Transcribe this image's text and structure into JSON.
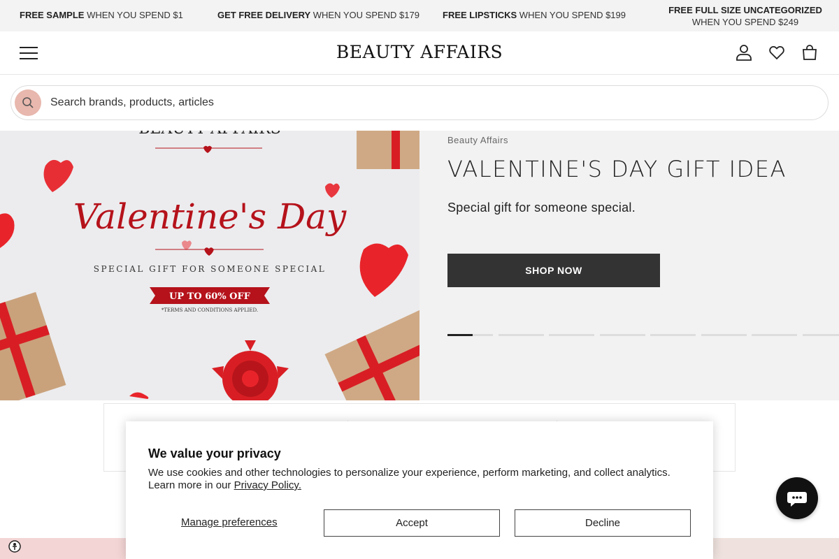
{
  "promo_bar": {
    "items": [
      {
        "bold": "FREE SAMPLE",
        "rest": " WHEN YOU SPEND $1"
      },
      {
        "bold": "GET FREE DELIVERY",
        "rest": " WHEN YOU SPEND $179"
      },
      {
        "bold": "FREE LIPSTICKS",
        "rest": " WHEN YOU SPEND $199"
      },
      {
        "bold": "FREE FULL SIZE UNCATEGORIZED",
        "rest": " WHEN YOU SPEND $249"
      }
    ]
  },
  "header": {
    "logo": "BEAUTY AFFAIRS",
    "icons": [
      "menu-icon",
      "account-icon",
      "heart-icon",
      "bag-icon"
    ]
  },
  "search": {
    "placeholder": "Search brands, products, articles"
  },
  "hero": {
    "image": {
      "brand_text": "BEAUTY AFFAIRS",
      "headline": "Valentine's Day",
      "tagline": "SPECIAL GIFT FOR SOMEONE SPECIAL",
      "offer": "UP TO 60% OFF",
      "terms": "*TERMS AND CONDITIONS APPLIED."
    },
    "brand": "Beauty Affairs",
    "title": "VALENTINE'S DAY GIFT IDEA",
    "subtitle": "Special gift for someone special.",
    "cta": "SHOP NOW",
    "slides_total": 8,
    "active_slide": 1
  },
  "cookie_modal": {
    "title": "We value your privacy",
    "text": "We use cookies and other technologies to personalize your experience, perform marketing, and collect analytics. Learn more in our ",
    "link": "Privacy Policy.",
    "manage": "Manage preferences",
    "accept": "Accept",
    "decline": "Decline"
  },
  "colors": {
    "accent_pink": "#e8b7ad",
    "button_dark": "#333333",
    "valentine_red": "#b5121b"
  }
}
